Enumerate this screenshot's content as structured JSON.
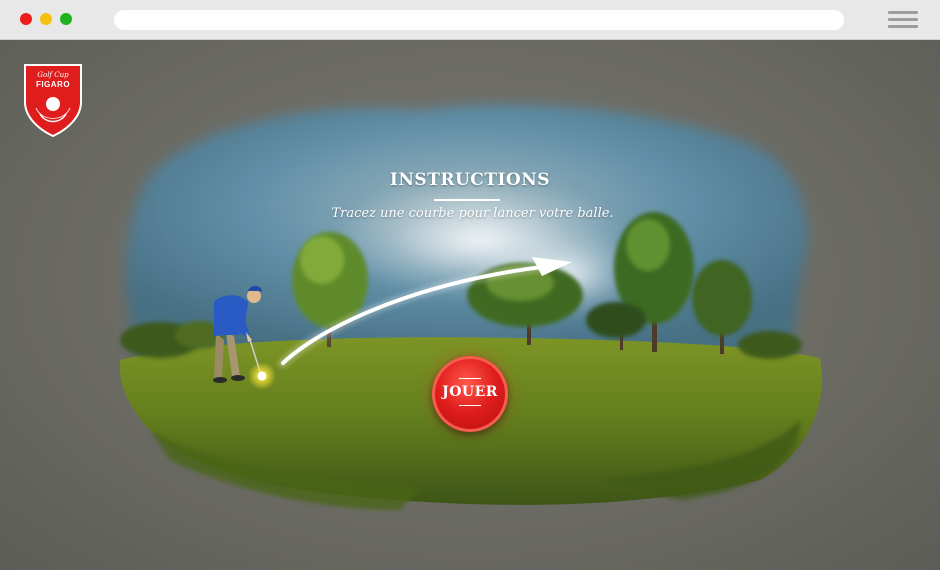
{
  "logo": {
    "line1": "Golf Cup",
    "line2": "FIGARO"
  },
  "instructions": {
    "title": "INSTRUCTIONS",
    "text": "Tracez une courbe pour lancer votre balle."
  },
  "play_button": {
    "label": "JOUER"
  },
  "colors": {
    "accent_red": "#e01d1d",
    "grass": "#6f8a1f",
    "sky": "#5f8ea6",
    "background": "#6d6d66"
  }
}
